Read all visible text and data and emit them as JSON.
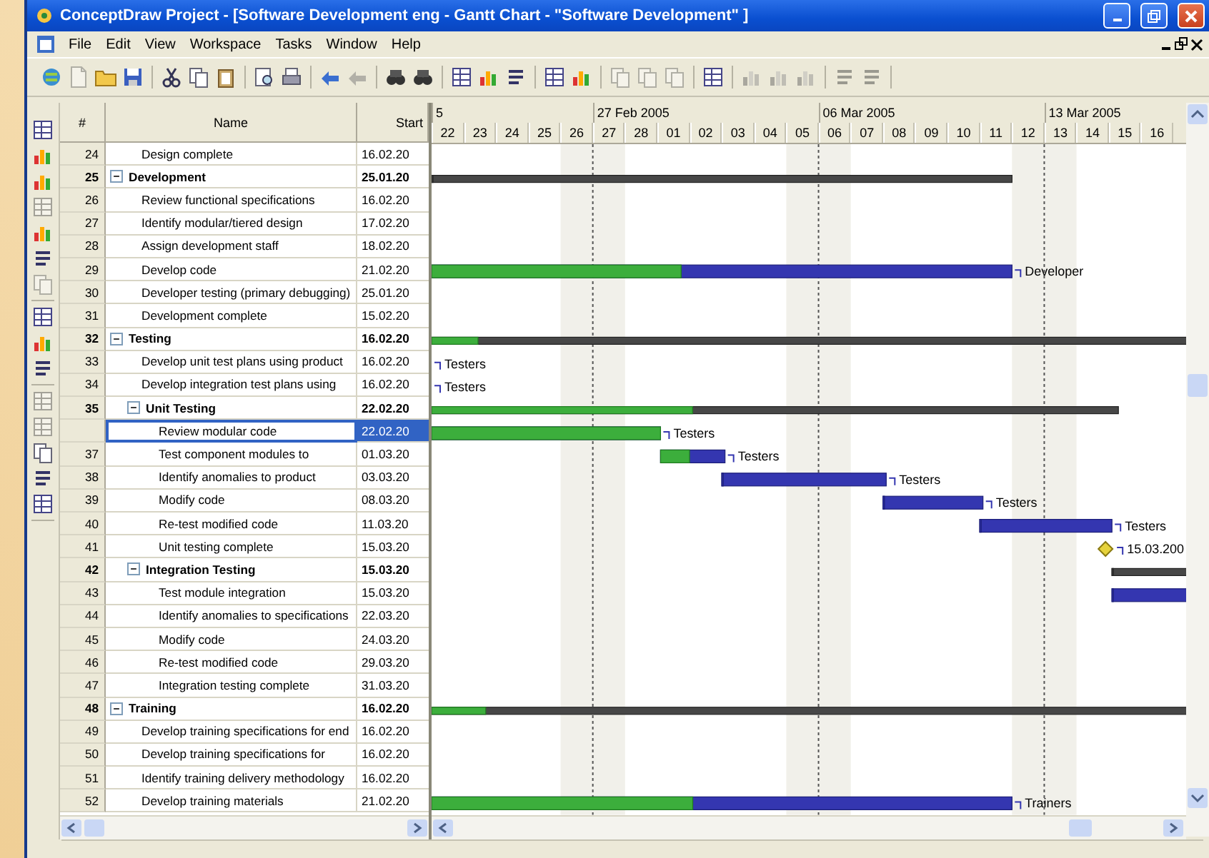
{
  "window": {
    "title": "ConceptDraw Project - [Software Development eng - Gantt Chart - \"Software Development\" ]"
  },
  "menu": [
    "File",
    "Edit",
    "View",
    "Workspace",
    "Tasks",
    "Window",
    "Help"
  ],
  "toolbar": [
    [
      {
        "disabled": false
      },
      {
        "disabled": true
      },
      {
        "disabled": false
      },
      {
        "disabled": false
      }
    ],
    [
      {
        "disabled": false
      },
      {
        "disabled": false
      },
      {
        "disabled": false
      }
    ],
    [
      {
        "disabled": false
      },
      {
        "disabled": false
      }
    ],
    [
      {
        "disabled": false
      },
      {
        "disabled": true
      }
    ],
    [
      {
        "disabled": false
      },
      {
        "disabled": false
      }
    ],
    [
      {
        "disabled": false
      },
      {
        "disabled": false
      },
      {
        "disabled": false
      }
    ],
    [
      {
        "disabled": false
      },
      {
        "disabled": false
      }
    ],
    [
      {
        "disabled": true
      },
      {
        "disabled": true
      },
      {
        "disabled": true
      }
    ],
    [
      {
        "disabled": false
      }
    ],
    [
      {
        "disabled": true
      },
      {
        "disabled": true
      },
      {
        "disabled": true
      }
    ],
    [
      {
        "disabled": true
      },
      {
        "disabled": true
      }
    ]
  ],
  "side_toolbar": [
    [
      {
        "disabled": false
      },
      {
        "disabled": false
      },
      {
        "disabled": false
      },
      {
        "disabled": true
      },
      {
        "disabled": false
      },
      {
        "disabled": false
      },
      {
        "disabled": true
      }
    ],
    [
      {
        "disabled": false
      },
      {
        "disabled": false
      },
      {
        "disabled": false
      }
    ],
    [
      {
        "disabled": true
      },
      {
        "disabled": true
      },
      {
        "disabled": false
      },
      {
        "disabled": false
      },
      {
        "disabled": false
      }
    ]
  ],
  "table": {
    "columns": [
      "#",
      "Name",
      "Start"
    ],
    "rows": [
      {
        "kind": "offscreen_parent",
        "children": [
          {
            "num": "24",
            "name": "Design complete",
            "start": "16.02.20",
            "kind": "task",
            "selected": false
          }
        ]
      },
      {
        "num": "25",
        "name": "Development",
        "start": "25.01.20",
        "kind": "summary",
        "expanded": true,
        "selected": false,
        "bar": {
          "kind": "summary",
          "level": 0
        },
        "children": [
          {
            "num": "26",
            "name": "Review functional specifications",
            "start": "16.02.20",
            "kind": "task",
            "selected": false
          },
          {
            "num": "27",
            "name": "Identify modular/tiered design",
            "start": "17.02.20",
            "kind": "task",
            "selected": false
          },
          {
            "num": "28",
            "name": "Assign development staff",
            "start": "18.02.20",
            "kind": "task",
            "selected": false
          },
          {
            "num": "29",
            "name": "Develop code",
            "start": "21.02.20",
            "kind": "task",
            "selected": false,
            "bar": {
              "kind": "task",
              "level": 0.43
            },
            "bar_label": "Developer"
          },
          {
            "num": "30",
            "name": "Developer testing (primary debugging)",
            "start": "25.01.20",
            "kind": "task",
            "selected": false
          },
          {
            "num": "31",
            "name": "Development complete",
            "start": "15.02.20",
            "kind": "task",
            "selected": false
          }
        ]
      },
      {
        "num": "32",
        "name": "Testing",
        "start": "16.02.20",
        "kind": "summary",
        "expanded": true,
        "selected": false,
        "bar": {
          "kind": "summary",
          "level": 0.06
        },
        "children": [
          {
            "num": "33",
            "name": "Develop unit test plans using product",
            "start": "16.02.20",
            "kind": "task",
            "selected": false,
            "bar_label": "Testers"
          },
          {
            "num": "34",
            "name": "Develop integration test plans using",
            "start": "16.02.20",
            "kind": "task",
            "selected": false,
            "bar_label": "Testers"
          },
          {
            "num": "35",
            "name": "Unit Testing",
            "start": "22.02.20",
            "kind": "summary",
            "expanded": true,
            "selected": false,
            "bar": {
              "kind": "summary",
              "level": 0.38
            },
            "children": [
              {
                "name": "Review modular code",
                "start": "22.02.20",
                "kind": "task",
                "selected": true,
                "bar": {
                  "kind": "task",
                  "level": 1
                },
                "bar_label": "Testers"
              },
              {
                "num": "37",
                "name": "Test component modules to",
                "start": "01.03.20",
                "kind": "task",
                "selected": false,
                "bar": {
                  "kind": "task",
                  "level": 0.45
                },
                "bar_label": "Testers"
              },
              {
                "num": "38",
                "name": "Identify anomalies to product",
                "start": "03.03.20",
                "kind": "task",
                "selected": false,
                "bar": {
                  "kind": "task",
                  "level": 0
                },
                "bar_label": "Testers"
              },
              {
                "num": "39",
                "name": "Modify code",
                "start": "08.03.20",
                "kind": "task",
                "selected": false,
                "bar": {
                  "kind": "task",
                  "level": 0
                },
                "bar_label": "Testers"
              },
              {
                "num": "40",
                "name": "Re-test modified code",
                "start": "11.03.20",
                "kind": "task",
                "selected": false,
                "bar": {
                  "kind": "task",
                  "level": 0
                },
                "bar_label": "Testers"
              },
              {
                "num": "41",
                "name": "Unit testing complete",
                "start": "15.03.20",
                "kind": "task",
                "selected": false,
                "bar": {
                  "kind": "milestone"
                },
                "bar_label": "15.03.200"
              }
            ]
          },
          {
            "num": "42",
            "name": "Integration Testing",
            "start": "15.03.20",
            "kind": "summary",
            "expanded": true,
            "selected": false,
            "bar": {
              "kind": "summary",
              "level": 0
            },
            "children": [
              {
                "num": "43",
                "name": "Test module integration",
                "start": "15.03.20",
                "kind": "task",
                "selected": false,
                "bar": {
                  "kind": "task",
                  "level": 0
                }
              },
              {
                "num": "44",
                "name": "Identify anomalies to specifications",
                "start": "22.03.20",
                "kind": "task",
                "selected": false
              },
              {
                "num": "45",
                "name": "Modify code",
                "start": "24.03.20",
                "kind": "task",
                "selected": false
              },
              {
                "num": "46",
                "name": "Re-test modified code",
                "start": "29.03.20",
                "kind": "task",
                "selected": false
              },
              {
                "num": "47",
                "name": "Integration testing complete",
                "start": "31.03.20",
                "kind": "task",
                "selected": false
              }
            ]
          }
        ]
      },
      {
        "num": "48",
        "name": "Training",
        "start": "16.02.20",
        "kind": "summary",
        "expanded": true,
        "selected": false,
        "bar": {
          "kind": "summary",
          "level": 0.07
        },
        "children": [
          {
            "num": "49",
            "name": "Develop training specifications for end",
            "start": "16.02.20",
            "kind": "task",
            "selected": false
          },
          {
            "num": "50",
            "name": "Develop training specifications for",
            "start": "16.02.20",
            "kind": "task",
            "selected": false
          },
          {
            "num": "51",
            "name": "Identify training delivery methodology",
            "start": "16.02.20",
            "kind": "task",
            "selected": false
          },
          {
            "num": "52",
            "name": "Develop training materials",
            "start": "21.02.20",
            "kind": "task",
            "selected": false,
            "bar": {
              "kind": "task",
              "level": 0.45
            },
            "bar_label": "Trainers"
          }
        ]
      }
    ]
  },
  "timescale": {
    "weeks": [
      "5",
      "27 Feb 2005",
      "06 Mar 2005",
      "13 Mar 2005"
    ],
    "days": [
      {
        "label": "22",
        "weekend": false
      },
      {
        "label": "23",
        "weekend": false
      },
      {
        "label": "24",
        "weekend": false
      },
      {
        "label": "25",
        "weekend": false
      },
      {
        "label": "26",
        "weekend": true
      },
      {
        "label": "27",
        "weekend": true
      },
      {
        "label": "28",
        "weekend": false
      },
      {
        "label": "01",
        "weekend": false
      },
      {
        "label": "02",
        "weekend": false
      },
      {
        "label": "03",
        "weekend": false
      },
      {
        "label": "04",
        "weekend": false
      },
      {
        "label": "05",
        "weekend": true
      },
      {
        "label": "06",
        "weekend": true
      },
      {
        "label": "07",
        "weekend": false
      },
      {
        "label": "08",
        "weekend": false
      },
      {
        "label": "09",
        "weekend": false
      },
      {
        "label": "10",
        "weekend": false
      },
      {
        "label": "11",
        "weekend": false
      },
      {
        "label": "12",
        "weekend": true
      },
      {
        "label": "13",
        "weekend": true
      },
      {
        "label": "14",
        "weekend": false
      },
      {
        "label": "15",
        "weekend": false
      },
      {
        "label": "16",
        "weekend": false
      }
    ]
  }
}
